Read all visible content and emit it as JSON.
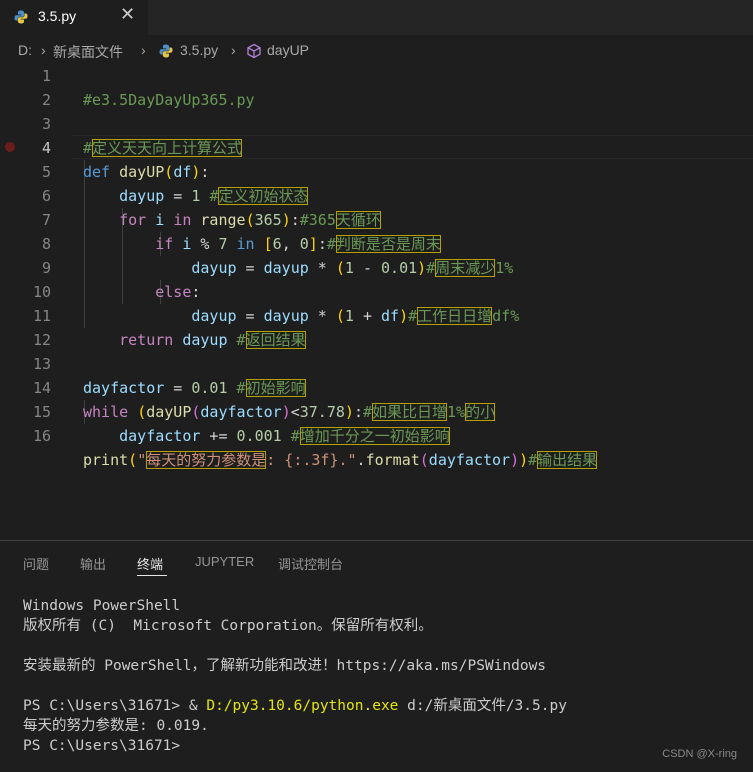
{
  "tab": {
    "filename": "3.5.py",
    "close_glyph": "✕"
  },
  "breadcrumb": {
    "drive": "D:",
    "folder": "新桌面文件",
    "file": "3.5.py",
    "symbol": "dayUP",
    "sep": "›"
  },
  "editor": {
    "line_numbers": [
      "1",
      "2",
      "3",
      "4",
      "5",
      "6",
      "7",
      "8",
      "9",
      "10",
      "11",
      "12",
      "13",
      "14",
      "15",
      "16"
    ],
    "l1": {
      "comment": "#e3.5DayDayUp365.py"
    },
    "l3": {
      "hash": "#",
      "comment": "定义天天向上计算公式"
    },
    "l4": {
      "def": "def",
      "sp": " ",
      "name": "dayUP",
      "lp": "(",
      "param": "df",
      "rp": ")",
      "colon": ":"
    },
    "l5": {
      "indent": "    ",
      "var": "dayup",
      "eq": " = ",
      "num": "1",
      "sp": " ",
      "hash": "#",
      "comment": "定义初始状态"
    },
    "l6": {
      "indent": "    ",
      "for": "for",
      "sp1": " ",
      "i": "i",
      "sp2": " ",
      "in": "in",
      "sp3": " ",
      "range": "range",
      "lp": "(",
      "num": "365",
      "rp": ")",
      "colon": ":",
      "hash": "#365",
      "comment": "天循环"
    },
    "l7": {
      "indent": "        ",
      "if": "if",
      "sp1": " ",
      "i": "i",
      "mod": " % ",
      "num": "7",
      "sp2": " ",
      "in": "in",
      "sp3": " ",
      "lb": "[",
      "n6": "6",
      "comma": ", ",
      "n0": "0",
      "rb": "]",
      "colon": ":",
      "hash": "#",
      "comment": "判断是否是周末"
    },
    "l8": {
      "indent": "            ",
      "var1": "dayup",
      "eq": " = ",
      "var2": "dayup",
      "mul": " * ",
      "lp": "(",
      "n1": "1",
      "minus": " - ",
      "n2": "0.01",
      "rp": ")",
      "hash": "#",
      "comment": "周末减少",
      "tail": "1%"
    },
    "l9": {
      "indent": "        ",
      "else": "else",
      "colon": ":"
    },
    "l10": {
      "indent": "            ",
      "var1": "dayup",
      "eq": " = ",
      "var2": "dayup",
      "mul": " * ",
      "lp": "(",
      "n1": "1",
      "plus": " + ",
      "df": "df",
      "rp": ")",
      "hash": "#",
      "comment": "工作日日增",
      "tail": "df%"
    },
    "l11": {
      "indent": "    ",
      "return": "return",
      "sp": " ",
      "var": "dayup",
      "sp2": " ",
      "hash": "#",
      "comment": "返回结果"
    },
    "l13": {
      "var": "dayfactor",
      "eq": " = ",
      "num": "0.01",
      "sp": " ",
      "hash": "#",
      "comment": "初始影响"
    },
    "l14": {
      "while": "while",
      "sp": " ",
      "lp": "(",
      "fn": "dayUP",
      "lp2": "(",
      "var": "dayfactor",
      "rp2": ")",
      "lt": "<",
      "num": "37.78",
      "rp": ")",
      "colon": ":",
      "hash": "#",
      "comment": "如果比日增",
      "tail": "1%",
      "comment2": "的小"
    },
    "l15": {
      "indent": "    ",
      "var": "dayfactor",
      "op": " += ",
      "num": "0.001",
      "sp": " ",
      "hash": "#",
      "comment": "增加千分之一初始影响"
    },
    "l16": {
      "print": "print",
      "lp": "(",
      "q1": "\"",
      "strcn": "每天的努力参数是",
      "strrest": ": {:.3f}.\"",
      "dot": ".",
      "format": "format",
      "lp2": "(",
      "var": "dayfactor",
      "rp2": ")",
      "rp": ")",
      "hash": "#",
      "comment": "输出结果"
    }
  },
  "panel": {
    "tabs": [
      "问题",
      "输出",
      "终端",
      "JUPYTER",
      "调试控制台"
    ],
    "active_tab": "终端",
    "terminal": {
      "t1": "Windows PowerShell",
      "t2": "版权所有 (C)  Microsoft Corporation。保留所有权利。",
      "t3": "安装最新的 PowerShell，了解新功能和改进！https://aka.ms/PSWindows",
      "t4_prompt": "PS C:\\Users\\31671> ",
      "t4_amp": "& ",
      "t4_exe": "D:/py3.10.6/python.exe",
      "t4_arg": " d:/新桌面文件/3.5.py",
      "t5": "每天的努力参数是: 0.019.",
      "t6": "PS C:\\Users\\31671>"
    }
  },
  "watermark": "CSDN @X-ring",
  "colors": {
    "background": "#1e1e1e",
    "keyword": "#569cd6",
    "control": "#c586c0",
    "function": "#dcdcaa",
    "variable": "#9cdcfe",
    "number": "#b5cea8",
    "string": "#ce9178",
    "comment": "#6a9955"
  }
}
